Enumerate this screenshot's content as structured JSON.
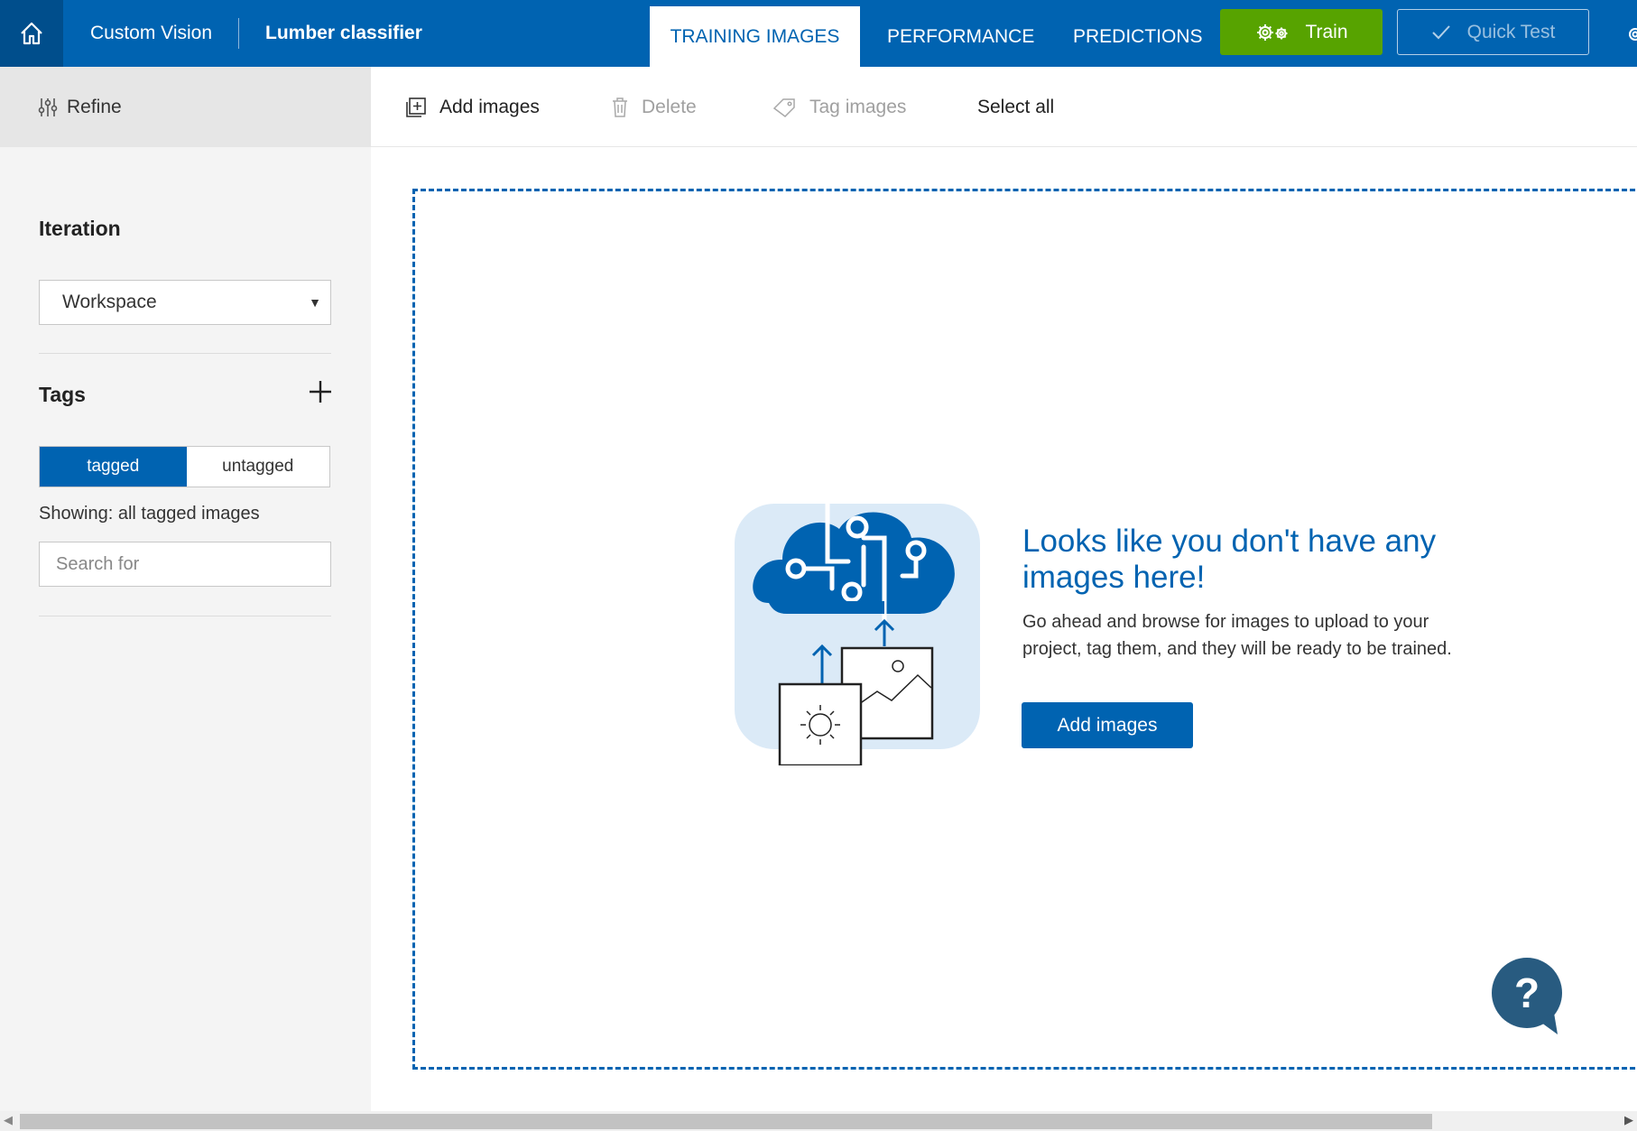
{
  "header": {
    "home_icon": "home-icon",
    "app_name": "Custom Vision",
    "project_name": "Lumber classifier",
    "tabs": [
      {
        "label": "TRAINING IMAGES",
        "active": true
      },
      {
        "label": "PERFORMANCE",
        "active": false
      },
      {
        "label": "PREDICTIONS",
        "active": false
      }
    ],
    "train_label": "Train",
    "quick_test_label": "Quick Test",
    "colors": {
      "bar": "#0063b1",
      "train": "#57a300"
    }
  },
  "sidebar": {
    "refine_label": "Refine",
    "iteration_heading": "Iteration",
    "iteration_value": "Workspace",
    "tags_heading": "Tags",
    "toggle": {
      "tagged": "tagged",
      "untagged": "untagged",
      "selected": "tagged"
    },
    "showing_text": "Showing: all tagged images",
    "search_placeholder": "Search for"
  },
  "toolbar": {
    "add_images": "Add images",
    "delete": "Delete",
    "tag_images": "Tag images",
    "select_all": "Select all"
  },
  "empty_state": {
    "title": "Looks like you don't have any images here!",
    "description": "Go ahead and browse for images to upload to your project, tag them, and they will be ready to be trained.",
    "button_label": "Add images"
  },
  "help": {
    "icon": "help-icon",
    "glyph": "?"
  }
}
